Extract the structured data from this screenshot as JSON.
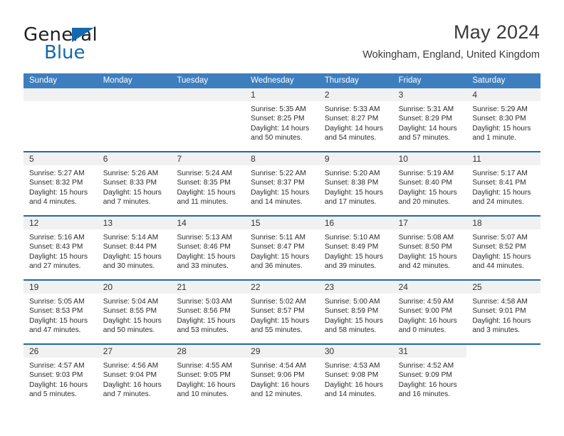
{
  "brand": {
    "name_top": "General",
    "name_bottom": "Blue",
    "accent_color": "#1269b0"
  },
  "header": {
    "title": "May 2024",
    "subtitle": "Wokingham, England, United Kingdom"
  },
  "theme": {
    "header_row_bg": "#3d7ebf",
    "row_divider": "#1f69ae",
    "day_band_bg": "#f1f1f1"
  },
  "weekdays": [
    "Sunday",
    "Monday",
    "Tuesday",
    "Wednesday",
    "Thursday",
    "Friday",
    "Saturday"
  ],
  "weeks": [
    [
      {
        "type": "empty"
      },
      {
        "type": "empty"
      },
      {
        "type": "empty"
      },
      {
        "type": "day",
        "date": "1",
        "sunrise": "Sunrise: 5:35 AM",
        "sunset": "Sunset: 8:25 PM",
        "daylight1": "Daylight: 14 hours",
        "daylight2": "and 50 minutes."
      },
      {
        "type": "day",
        "date": "2",
        "sunrise": "Sunrise: 5:33 AM",
        "sunset": "Sunset: 8:27 PM",
        "daylight1": "Daylight: 14 hours",
        "daylight2": "and 54 minutes."
      },
      {
        "type": "day",
        "date": "3",
        "sunrise": "Sunrise: 5:31 AM",
        "sunset": "Sunset: 8:29 PM",
        "daylight1": "Daylight: 14 hours",
        "daylight2": "and 57 minutes."
      },
      {
        "type": "day",
        "date": "4",
        "sunrise": "Sunrise: 5:29 AM",
        "sunset": "Sunset: 8:30 PM",
        "daylight1": "Daylight: 15 hours",
        "daylight2": "and 1 minute."
      }
    ],
    [
      {
        "type": "day",
        "date": "5",
        "sunrise": "Sunrise: 5:27 AM",
        "sunset": "Sunset: 8:32 PM",
        "daylight1": "Daylight: 15 hours",
        "daylight2": "and 4 minutes."
      },
      {
        "type": "day",
        "date": "6",
        "sunrise": "Sunrise: 5:26 AM",
        "sunset": "Sunset: 8:33 PM",
        "daylight1": "Daylight: 15 hours",
        "daylight2": "and 7 minutes."
      },
      {
        "type": "day",
        "date": "7",
        "sunrise": "Sunrise: 5:24 AM",
        "sunset": "Sunset: 8:35 PM",
        "daylight1": "Daylight: 15 hours",
        "daylight2": "and 11 minutes."
      },
      {
        "type": "day",
        "date": "8",
        "sunrise": "Sunrise: 5:22 AM",
        "sunset": "Sunset: 8:37 PM",
        "daylight1": "Daylight: 15 hours",
        "daylight2": "and 14 minutes."
      },
      {
        "type": "day",
        "date": "9",
        "sunrise": "Sunrise: 5:20 AM",
        "sunset": "Sunset: 8:38 PM",
        "daylight1": "Daylight: 15 hours",
        "daylight2": "and 17 minutes."
      },
      {
        "type": "day",
        "date": "10",
        "sunrise": "Sunrise: 5:19 AM",
        "sunset": "Sunset: 8:40 PM",
        "daylight1": "Daylight: 15 hours",
        "daylight2": "and 20 minutes."
      },
      {
        "type": "day",
        "date": "11",
        "sunrise": "Sunrise: 5:17 AM",
        "sunset": "Sunset: 8:41 PM",
        "daylight1": "Daylight: 15 hours",
        "daylight2": "and 24 minutes."
      }
    ],
    [
      {
        "type": "day",
        "date": "12",
        "sunrise": "Sunrise: 5:16 AM",
        "sunset": "Sunset: 8:43 PM",
        "daylight1": "Daylight: 15 hours",
        "daylight2": "and 27 minutes."
      },
      {
        "type": "day",
        "date": "13",
        "sunrise": "Sunrise: 5:14 AM",
        "sunset": "Sunset: 8:44 PM",
        "daylight1": "Daylight: 15 hours",
        "daylight2": "and 30 minutes."
      },
      {
        "type": "day",
        "date": "14",
        "sunrise": "Sunrise: 5:13 AM",
        "sunset": "Sunset: 8:46 PM",
        "daylight1": "Daylight: 15 hours",
        "daylight2": "and 33 minutes."
      },
      {
        "type": "day",
        "date": "15",
        "sunrise": "Sunrise: 5:11 AM",
        "sunset": "Sunset: 8:47 PM",
        "daylight1": "Daylight: 15 hours",
        "daylight2": "and 36 minutes."
      },
      {
        "type": "day",
        "date": "16",
        "sunrise": "Sunrise: 5:10 AM",
        "sunset": "Sunset: 8:49 PM",
        "daylight1": "Daylight: 15 hours",
        "daylight2": "and 39 minutes."
      },
      {
        "type": "day",
        "date": "17",
        "sunrise": "Sunrise: 5:08 AM",
        "sunset": "Sunset: 8:50 PM",
        "daylight1": "Daylight: 15 hours",
        "daylight2": "and 42 minutes."
      },
      {
        "type": "day",
        "date": "18",
        "sunrise": "Sunrise: 5:07 AM",
        "sunset": "Sunset: 8:52 PM",
        "daylight1": "Daylight: 15 hours",
        "daylight2": "and 44 minutes."
      }
    ],
    [
      {
        "type": "day",
        "date": "19",
        "sunrise": "Sunrise: 5:05 AM",
        "sunset": "Sunset: 8:53 PM",
        "daylight1": "Daylight: 15 hours",
        "daylight2": "and 47 minutes."
      },
      {
        "type": "day",
        "date": "20",
        "sunrise": "Sunrise: 5:04 AM",
        "sunset": "Sunset: 8:55 PM",
        "daylight1": "Daylight: 15 hours",
        "daylight2": "and 50 minutes."
      },
      {
        "type": "day",
        "date": "21",
        "sunrise": "Sunrise: 5:03 AM",
        "sunset": "Sunset: 8:56 PM",
        "daylight1": "Daylight: 15 hours",
        "daylight2": "and 53 minutes."
      },
      {
        "type": "day",
        "date": "22",
        "sunrise": "Sunrise: 5:02 AM",
        "sunset": "Sunset: 8:57 PM",
        "daylight1": "Daylight: 15 hours",
        "daylight2": "and 55 minutes."
      },
      {
        "type": "day",
        "date": "23",
        "sunrise": "Sunrise: 5:00 AM",
        "sunset": "Sunset: 8:59 PM",
        "daylight1": "Daylight: 15 hours",
        "daylight2": "and 58 minutes."
      },
      {
        "type": "day",
        "date": "24",
        "sunrise": "Sunrise: 4:59 AM",
        "sunset": "Sunset: 9:00 PM",
        "daylight1": "Daylight: 16 hours",
        "daylight2": "and 0 minutes."
      },
      {
        "type": "day",
        "date": "25",
        "sunrise": "Sunrise: 4:58 AM",
        "sunset": "Sunset: 9:01 PM",
        "daylight1": "Daylight: 16 hours",
        "daylight2": "and 3 minutes."
      }
    ],
    [
      {
        "type": "day",
        "date": "26",
        "sunrise": "Sunrise: 4:57 AM",
        "sunset": "Sunset: 9:03 PM",
        "daylight1": "Daylight: 16 hours",
        "daylight2": "and 5 minutes."
      },
      {
        "type": "day",
        "date": "27",
        "sunrise": "Sunrise: 4:56 AM",
        "sunset": "Sunset: 9:04 PM",
        "daylight1": "Daylight: 16 hours",
        "daylight2": "and 7 minutes."
      },
      {
        "type": "day",
        "date": "28",
        "sunrise": "Sunrise: 4:55 AM",
        "sunset": "Sunset: 9:05 PM",
        "daylight1": "Daylight: 16 hours",
        "daylight2": "and 10 minutes."
      },
      {
        "type": "day",
        "date": "29",
        "sunrise": "Sunrise: 4:54 AM",
        "sunset": "Sunset: 9:06 PM",
        "daylight1": "Daylight: 16 hours",
        "daylight2": "and 12 minutes."
      },
      {
        "type": "day",
        "date": "30",
        "sunrise": "Sunrise: 4:53 AM",
        "sunset": "Sunset: 9:08 PM",
        "daylight1": "Daylight: 16 hours",
        "daylight2": "and 14 minutes."
      },
      {
        "type": "day",
        "date": "31",
        "sunrise": "Sunrise: 4:52 AM",
        "sunset": "Sunset: 9:09 PM",
        "daylight1": "Daylight: 16 hours",
        "daylight2": "and 16 minutes."
      },
      {
        "type": "blank"
      }
    ]
  ]
}
